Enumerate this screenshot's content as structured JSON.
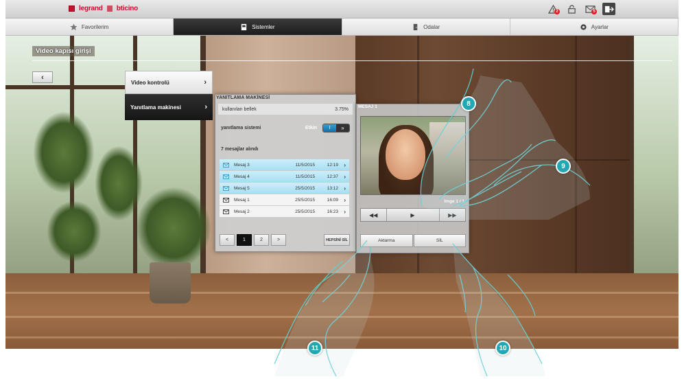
{
  "brand": {
    "logo1": "legrand",
    "logo2": "bticino"
  },
  "topbar": {
    "icons": [
      {
        "name": "alarm-icon",
        "badge": "2"
      },
      {
        "name": "lock-icon",
        "badge": ""
      },
      {
        "name": "message-icon",
        "badge": "5"
      },
      {
        "name": "exit-icon",
        "badge": ""
      }
    ]
  },
  "nav": {
    "tabs": [
      {
        "label": "Favorilerim",
        "icon": "star-icon",
        "active": false
      },
      {
        "label": "Sistemler",
        "icon": "system-icon",
        "active": true
      },
      {
        "label": "Odalar",
        "icon": "door-icon",
        "active": false
      },
      {
        "label": "Ayarlar",
        "icon": "settings-icon",
        "active": false
      }
    ]
  },
  "page": {
    "title": "Video kapısı girişi",
    "back_label": "‹"
  },
  "sidemenu": {
    "items": [
      {
        "label": "Video kontrolü",
        "arrow": "›"
      },
      {
        "label": "Yanıtlama makinesi",
        "arrow": "›"
      }
    ]
  },
  "answering_machine": {
    "title": "YANITLAMA MAKİNESİ",
    "memory_label": "kullanılan bellek",
    "memory_value": "3.75%",
    "system_label": "yanıtlama sistemi",
    "system_state": "Etkin",
    "toggle_on": "I",
    "toggle_off": "»",
    "received": "7 mesajlar alındı",
    "messages": [
      {
        "name": "Mesaj 3",
        "date": "11/5/2015",
        "time": "12:19",
        "new": true
      },
      {
        "name": "Mesaj 4",
        "date": "11/5/2015",
        "time": "12:37",
        "new": true
      },
      {
        "name": "Mesaj 5",
        "date": "25/5/2015",
        "time": "13:12",
        "new": true
      },
      {
        "name": "Mesaj 1",
        "date": "25/5/2015",
        "time": "16:09",
        "new": false
      },
      {
        "name": "Mesaj 2",
        "date": "25/5/2015",
        "time": "16:23",
        "new": false
      }
    ],
    "pager": {
      "prev": "<",
      "pages": [
        "1",
        "2"
      ],
      "next": ">",
      "current": "1"
    },
    "delete_all": "HEPSİNİ SİL"
  },
  "viewer": {
    "title": "MESAJ 1",
    "image_counter": "Imge 1 / 1",
    "controls": {
      "rewind": "◀◀",
      "play": "▶",
      "forward": "▶▶"
    },
    "forward_button": "Aktarma",
    "delete_button": "SİL"
  },
  "callouts": [
    "8",
    "9",
    "10",
    "11"
  ],
  "colors": {
    "accent": "#21a8b3",
    "message_new": "#a6dff3",
    "toggle_on": "#1e8cc4",
    "brand_red": "#c8102e"
  }
}
